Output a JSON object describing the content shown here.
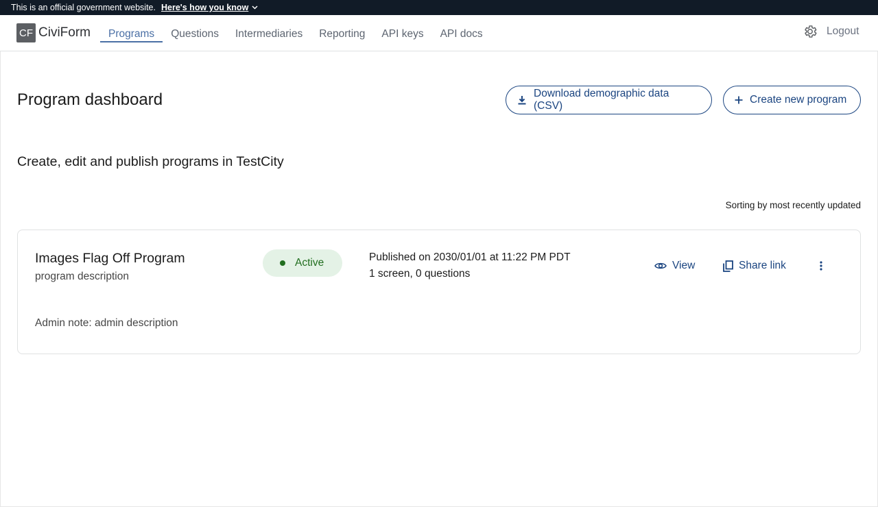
{
  "banner": {
    "text": "This is an official government website.",
    "link": "Here's how you know"
  },
  "header": {
    "logo_mark": "CF",
    "logo_text": "CiviForm",
    "nav": [
      "Programs",
      "Questions",
      "Intermediaries",
      "Reporting",
      "API keys",
      "API docs"
    ],
    "active_nav": "Programs",
    "logout": "Logout",
    "settings_icon": "gear-icon"
  },
  "main": {
    "title": "Program dashboard",
    "download_button": "Download demographic data (CSV)",
    "create_button": "Create new program",
    "subtitle": "Create, edit and publish programs in TestCity",
    "sort_label": "Sorting by most recently updated"
  },
  "programs": [
    {
      "name": "Images Flag Off Program",
      "description": "program description",
      "status": "Active",
      "published": "Published on 2030/01/01 at 11:22 PM PDT",
      "counts": "1 screen, 0 questions",
      "view_label": "View",
      "share_label": "Share link",
      "admin_note": "Admin note: admin description"
    }
  ],
  "colors": {
    "banner_bg": "#111b27",
    "accent": "#1a4480",
    "nav_active": "#4a6fa5",
    "badge_bg": "#e4f2e6",
    "badge_text": "#216e1f"
  }
}
